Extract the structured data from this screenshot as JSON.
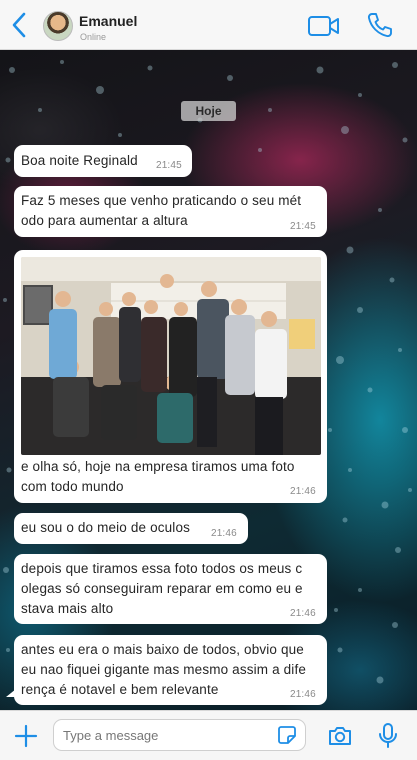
{
  "header": {
    "contact_name": "Emanuel",
    "contact_status": "Online",
    "icons": [
      "chevron-left-icon",
      "avatar",
      "video-camera-icon",
      "phone-icon"
    ]
  },
  "chat": {
    "date_label": "Hoje",
    "messages": [
      {
        "text_lines": [
          "Boa noite Reginald"
        ],
        "time": "21:45"
      },
      {
        "text_lines": [
          "Faz 5 meses que venho praticando o seu mét",
          "odo para aumentar a altura"
        ],
        "time": "21:45"
      },
      {
        "image": "group-photo",
        "text_lines": [
          "e olha só, hoje na empresa tiramos uma foto",
          "com todo mundo"
        ],
        "time": "21:46"
      },
      {
        "text_lines": [
          "eu sou o do meio de oculos"
        ],
        "time": "21:46"
      },
      {
        "text_lines": [
          "depois que tiramos essa foto todos os meus c",
          "olegas só conseguiram reparar em como eu e",
          "stava mais alto"
        ],
        "time": "21:46"
      },
      {
        "text_lines": [
          "antes eu era o mais baixo de todos, obvio que",
          "eu nao fiquei gigante mas mesmo assim a dife",
          "rença é notavel e bem relevante"
        ],
        "time": "21:46"
      }
    ]
  },
  "input_bar": {
    "placeholder": "Type a message",
    "icons": [
      "plus-icon",
      "sticker-icon",
      "camera-icon",
      "microphone-icon"
    ]
  },
  "colors": {
    "accent": "#1e8ee6",
    "bubble": "#ffffff",
    "time_text": "#8a8a8a"
  }
}
